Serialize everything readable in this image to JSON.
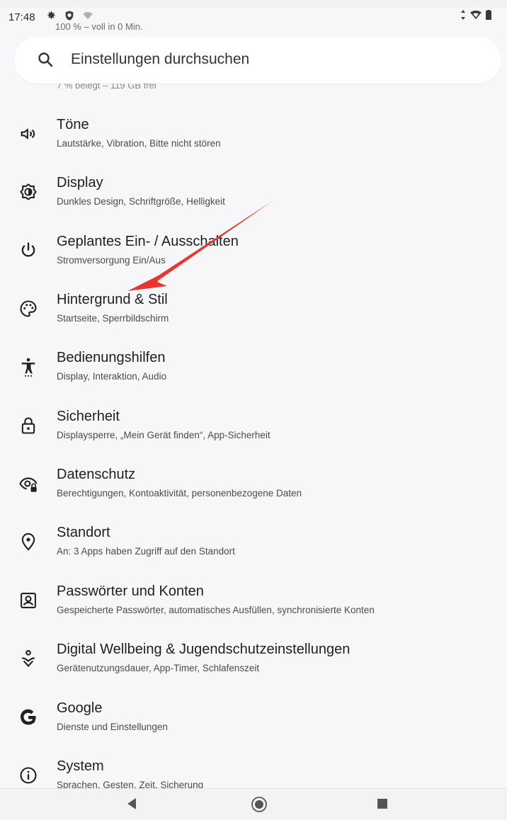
{
  "status_bar": {
    "time": "17:48"
  },
  "peek_text_top": "100 % – voll in 0 Min.",
  "search": {
    "placeholder": "Einstellungen durchsuchen"
  },
  "peek_text_under_search": "7 % belegt – 119 GB frei",
  "settings": [
    {
      "title": "Töne",
      "subtitle": "Lautstärke, Vibration, Bitte nicht stören",
      "icon": "volume-icon"
    },
    {
      "title": "Display",
      "subtitle": "Dunkles Design, Schriftgröße, Helligkeit",
      "icon": "brightness-icon"
    },
    {
      "title": "Geplantes Ein- / Ausschalten",
      "subtitle": "Stromversorgung Ein/Aus",
      "icon": "power-icon"
    },
    {
      "title": "Hintergrund & Stil",
      "subtitle": "Startseite, Sperrbildschirm",
      "icon": "palette-icon"
    },
    {
      "title": "Bedienungshilfen",
      "subtitle": "Display, Interaktion, Audio",
      "icon": "accessibility-icon"
    },
    {
      "title": "Sicherheit",
      "subtitle": "Displaysperre, „Mein Gerät finden“, App-Sicherheit",
      "icon": "lock-icon"
    },
    {
      "title": "Datenschutz",
      "subtitle": "Berechtigungen, Kontoaktivität, personenbezogene Daten",
      "icon": "privacy-eye-icon"
    },
    {
      "title": "Standort",
      "subtitle": "An: 3 Apps haben Zugriff auf den Standort",
      "icon": "location-icon"
    },
    {
      "title": "Passwörter und Konten",
      "subtitle": "Gespeicherte Passwörter, automatisches Ausfüllen, synchronisierte Konten",
      "icon": "account-box-icon"
    },
    {
      "title": "Digital Wellbeing & Jugendschutzeinstellungen",
      "subtitle": "Gerätenutzungsdauer, App-Timer, Schlafenszeit",
      "icon": "wellbeing-icon"
    },
    {
      "title": "Google",
      "subtitle": "Dienste und Einstellungen",
      "icon": "google-icon"
    },
    {
      "title": "System",
      "subtitle": "Sprachen, Gesten, Zeit, Sicherung",
      "icon": "info-icon"
    }
  ],
  "annotation": {
    "arrow_color": "#e8372c"
  }
}
